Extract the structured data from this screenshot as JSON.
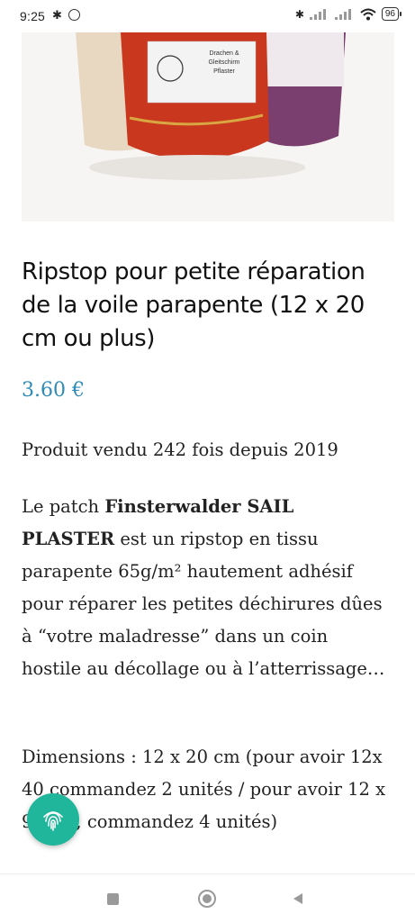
{
  "status_bar": {
    "time": "9:25",
    "battery": "96"
  },
  "product": {
    "title": "Ripstop pour petite réparation de la voile parapente (12 x 20 cm ou plus)",
    "price": "3.60 €",
    "sold_text": "Produit vendu 242 fois depuis 2019",
    "description": {
      "prefix": "Le patch ",
      "bold": "Finsterwalder SAIL PLASTER",
      "suffix": " est un ripstop en tissu parapente 65g/m² hautement adhésif pour réparer les petites déchirures dûes à “votre maladresse” dans un coin hostile au décollage ou à l’atterrissage…"
    },
    "dimensions": "Dimensions : 12 x 20 cm (pour avoir 12x 40 commandez 2 unités / pour avoir 12 x 90 cm, commandez 4 unités)",
    "image_label": {
      "line1": "Drachen &",
      "line2": "Gleitschirm",
      "line3": "Pflaster"
    }
  },
  "colors": {
    "price": "#2e8bb5",
    "fab": "#1fb69b"
  }
}
